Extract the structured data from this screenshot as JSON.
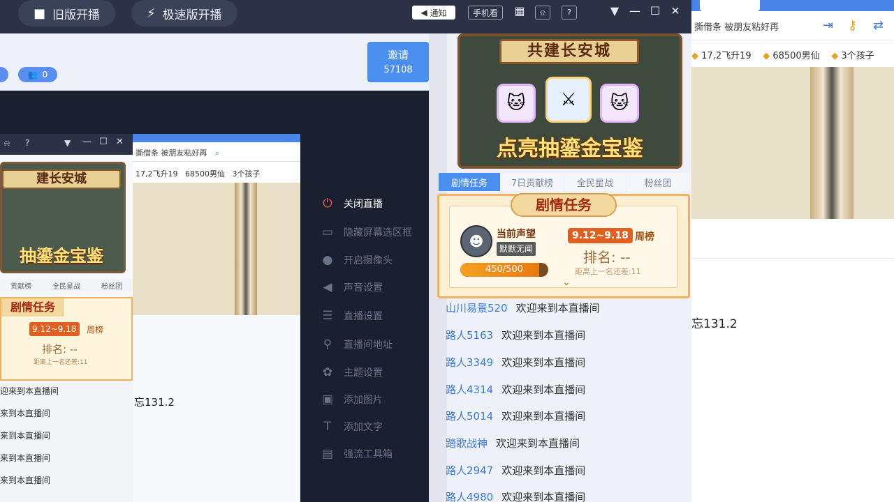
{
  "topbar": {
    "old_start": "旧版开播",
    "fast_start": "极速版开播",
    "notify": "通知",
    "phone_view": "手机看",
    "question": "?"
  },
  "invite": {
    "label": "邀请",
    "count": "57108"
  },
  "viewers": {
    "count": "0"
  },
  "menu": {
    "items": [
      {
        "label": "关闭直播",
        "icon": "power-icon"
      },
      {
        "label": "隐藏屏幕选区框",
        "icon": "monitor-icon"
      },
      {
        "label": "开启摄像头",
        "icon": "camera-icon"
      },
      {
        "label": "声音设置",
        "icon": "speaker-icon"
      },
      {
        "label": "直播设置",
        "icon": "sliders-icon"
      },
      {
        "label": "直播间地址",
        "icon": "location-icon"
      },
      {
        "label": "主题设置",
        "icon": "palette-icon"
      },
      {
        "label": "添加图片",
        "icon": "image-icon"
      },
      {
        "label": "添加文字",
        "icon": "text-icon"
      },
      {
        "label": "强流工具箱",
        "icon": "toolbox-icon"
      }
    ]
  },
  "banner": {
    "title": "共建长安城",
    "subtitle": "点亮抽鎏金宝鉴"
  },
  "tabs": [
    "剧情任务",
    "7日贡献榜",
    "全民星战",
    "粉丝团"
  ],
  "task": {
    "header": "剧情任务",
    "current_label": "当前声望",
    "nickname": "默默无闻",
    "progress_text": "450/500",
    "progress_fraction": 0.9,
    "week_range": "9.12~9.18",
    "week_label": "周榜",
    "rank": "排名: --",
    "distance": "距离上一名还差:11"
  },
  "chat": [
    {
      "user": "山川易景520",
      "msg": "欢迎来到本直播间"
    },
    {
      "user": "路人5163",
      "msg": "欢迎来到本直播间"
    },
    {
      "user": "路人3349",
      "msg": "欢迎来到本直播间"
    },
    {
      "user": "路人4314",
      "msg": "欢迎来到本直播间"
    },
    {
      "user": "路人5014",
      "msg": "欢迎来到本直播间"
    },
    {
      "user": "踏歌战神",
      "msg": "欢迎来到本直播间"
    },
    {
      "user": "路人2947",
      "msg": "欢迎来到本直播间"
    },
    {
      "user": "路人4980",
      "msg": "欢迎来到本直播间"
    }
  ],
  "browser": {
    "url_text": "撕借条 被朋友粘好再",
    "bookmarks": [
      "17,2飞升19",
      "68500男仙",
      "3个孩子"
    ],
    "value": "忘131.2"
  },
  "mini": {
    "title": "建长安城",
    "subtitle": "抽鎏金宝鉴",
    "url_text": "撕借条 被朋友粘好再",
    "bookmarks": [
      "17,2飞升19",
      "68500男仙",
      "3个孩子"
    ],
    "tabs": [
      "贡献榜",
      "全民星战",
      "粉丝团"
    ],
    "task_header": "剧情任务",
    "week_range": "9.12~9.18",
    "week_label": "周榜",
    "rank": "排名: --",
    "distance": "距离上一名还差:11",
    "value": "忘131.2",
    "rows": [
      "迎来到本直播间",
      "来到本直播间",
      "来到本直播间",
      "来到本直播间",
      "来到本直播间"
    ]
  },
  "colors": {
    "accent": "#4a8ff0",
    "chat_user": "#3a7ae0",
    "menu_bg": "#1b2030",
    "power": "#ff5a5a"
  }
}
